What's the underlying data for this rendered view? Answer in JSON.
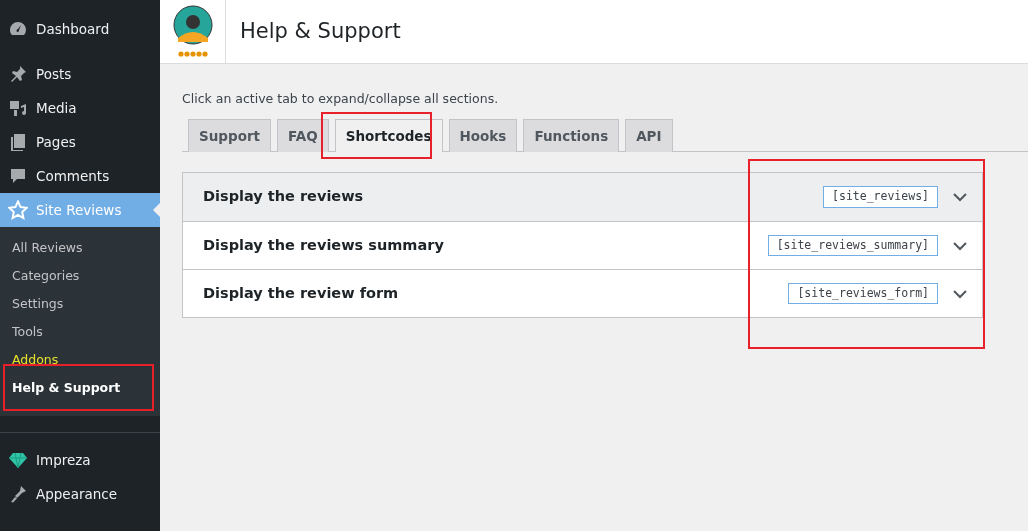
{
  "sidebar": {
    "items": [
      {
        "label": "Dashboard",
        "selected": false
      },
      {
        "label": "Posts",
        "selected": false
      },
      {
        "label": "Media",
        "selected": false
      },
      {
        "label": "Pages",
        "selected": false
      },
      {
        "label": "Comments",
        "selected": false
      },
      {
        "label": "Site Reviews",
        "selected": true,
        "children": [
          {
            "label": "All Reviews",
            "selected": false,
            "accent": false
          },
          {
            "label": "Categories",
            "selected": false,
            "accent": false
          },
          {
            "label": "Settings",
            "selected": false,
            "accent": false
          },
          {
            "label": "Tools",
            "selected": false,
            "accent": false
          },
          {
            "label": "Addons",
            "selected": false,
            "accent": true
          },
          {
            "label": "Help & Support",
            "selected": true,
            "accent": false
          }
        ]
      },
      {
        "label": "Impreza",
        "selected": false
      },
      {
        "label": "Appearance",
        "selected": false
      }
    ]
  },
  "header": {
    "title": "Help & Support"
  },
  "hint": "Click an active tab to expand/collapse all sections.",
  "tabs": [
    {
      "label": "Support",
      "selected": false
    },
    {
      "label": "FAQ",
      "selected": false
    },
    {
      "label": "Shortcodes",
      "selected": true
    },
    {
      "label": "Hooks",
      "selected": false
    },
    {
      "label": "Functions",
      "selected": false
    },
    {
      "label": "API",
      "selected": false
    }
  ],
  "sections": [
    {
      "title": "Display the reviews",
      "shortcode": "[site_reviews]",
      "expanded": false,
      "hovered": true
    },
    {
      "title": "Display the reviews summary",
      "shortcode": "[site_reviews_summary]",
      "expanded": false,
      "hovered": false
    },
    {
      "title": "Display the review form",
      "shortcode": "[site_reviews_form]",
      "expanded": false,
      "hovered": false
    }
  ]
}
